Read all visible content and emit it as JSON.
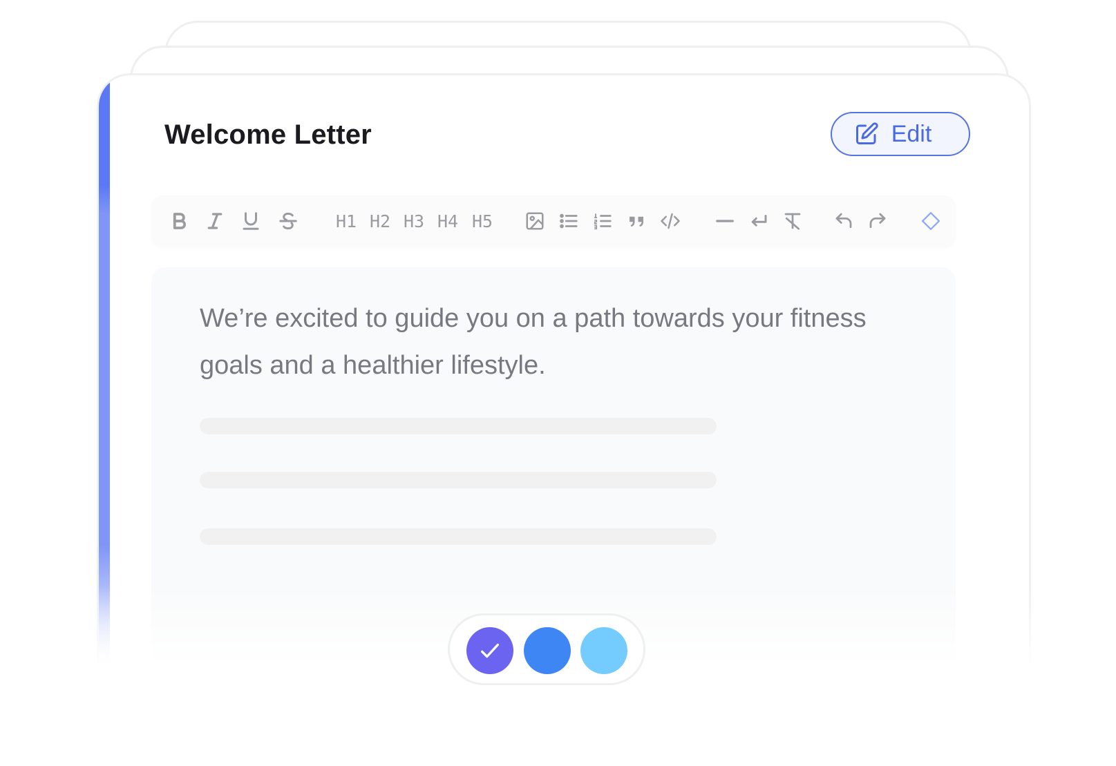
{
  "card": {
    "title": "Welcome Letter",
    "edit_label": "Edit"
  },
  "toolbar": {
    "buttons": [
      {
        "name": "bold-icon",
        "kind": "icon"
      },
      {
        "name": "italic-icon",
        "kind": "icon"
      },
      {
        "name": "underline-icon",
        "kind": "icon"
      },
      {
        "name": "strikethrough-icon",
        "kind": "icon"
      },
      {
        "name": "heading-1",
        "kind": "text",
        "label": "H1"
      },
      {
        "name": "heading-2",
        "kind": "text",
        "label": "H2"
      },
      {
        "name": "heading-3",
        "kind": "text",
        "label": "H3"
      },
      {
        "name": "heading-4",
        "kind": "text",
        "label": "H4"
      },
      {
        "name": "heading-5",
        "kind": "text",
        "label": "H5"
      },
      {
        "name": "image-icon",
        "kind": "icon"
      },
      {
        "name": "bullet-list-icon",
        "kind": "icon"
      },
      {
        "name": "numbered-list-icon",
        "kind": "icon"
      },
      {
        "name": "quote-icon",
        "kind": "icon"
      },
      {
        "name": "code-icon",
        "kind": "icon"
      },
      {
        "name": "horizontal-rule-icon",
        "kind": "icon"
      },
      {
        "name": "line-break-icon",
        "kind": "icon"
      },
      {
        "name": "clear-format-icon",
        "kind": "icon"
      },
      {
        "name": "undo-icon",
        "kind": "icon"
      },
      {
        "name": "redo-icon",
        "kind": "icon"
      },
      {
        "name": "diamond-icon",
        "kind": "icon"
      }
    ]
  },
  "editor": {
    "text": "We’re excited to guide you on a path towards your fitness goals and a healthier lifestyle."
  },
  "swatches": [
    {
      "color": "#6a64f0",
      "selected": true
    },
    {
      "color": "#3e86f3",
      "selected": false
    },
    {
      "color": "#73ccfd",
      "selected": false
    }
  ],
  "colors": {
    "accent": "#5b79f5",
    "edit_button": "#5474e4",
    "icon_gray": "#9a9ba1",
    "diamond_icon": "#8ba6f7"
  }
}
